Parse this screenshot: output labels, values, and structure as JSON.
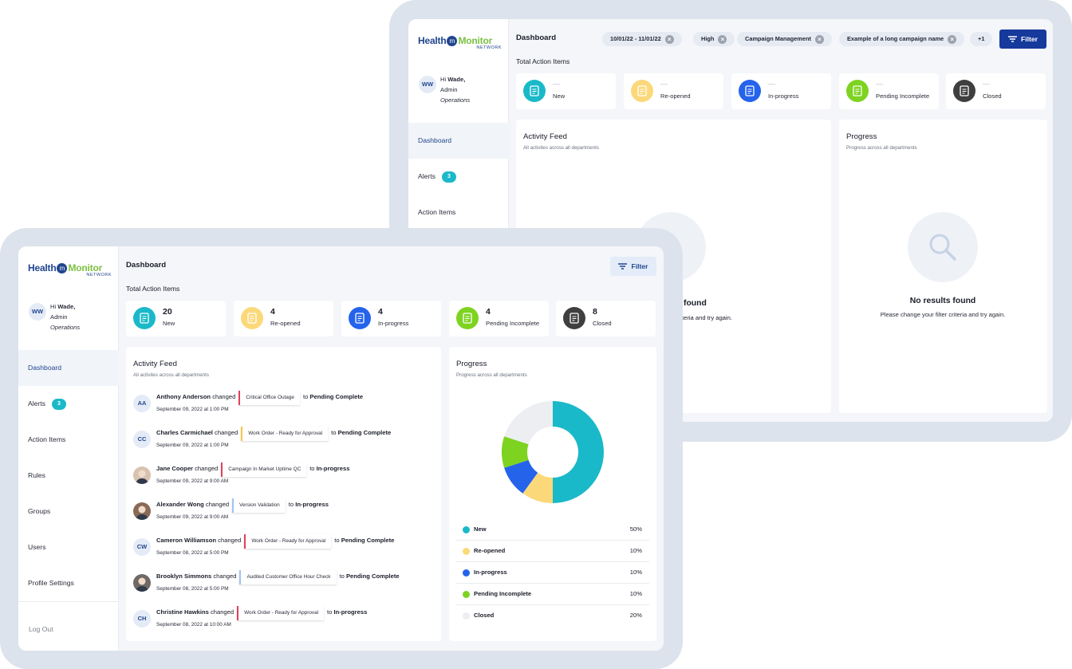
{
  "brand": {
    "health": "Health",
    "m": "m",
    "monitor": "Monitor",
    "network": "NETWORK"
  },
  "user": {
    "initials": "WW",
    "greeting": "Hi",
    "name": "Wade,",
    "role": "Admin",
    "dept": "Operations"
  },
  "back": {
    "page_title": "Dashboard",
    "filters": [
      {
        "label": "10/01/22 - 11/01/22"
      },
      {
        "label": "High"
      },
      {
        "label": "Campaign Management"
      },
      {
        "label": "Example of a long campaign name"
      }
    ],
    "more_filters": "+1",
    "filter_button": "Filter",
    "section_title": "Total Action Items",
    "stats": [
      {
        "value": "—",
        "label": "New"
      },
      {
        "value": "—",
        "label": "Re-opened"
      },
      {
        "value": "—",
        "label": "In-progress"
      },
      {
        "value": "—",
        "label": "Pending Incomplete"
      },
      {
        "value": "—",
        "label": "Closed"
      }
    ],
    "nav": [
      {
        "label": "Dashboard"
      },
      {
        "label": "Alerts",
        "badge": "3"
      },
      {
        "label": "Action Items"
      }
    ],
    "activity": {
      "title": "Activity Feed",
      "subtitle": "All activites across all departments",
      "empty_title_partial": "found",
      "empty_sub_partial": "criteria and try again."
    },
    "progress": {
      "title": "Progress",
      "subtitle": "Progress across all departments",
      "empty_title": "No results found",
      "empty_sub": "Please change your filter criteria and try again."
    }
  },
  "front": {
    "page_title": "Dashboard",
    "filter_button": "Filter",
    "section_title": "Total Action Items",
    "stats": [
      {
        "value": "20",
        "label": "New"
      },
      {
        "value": "4",
        "label": "Re-opened"
      },
      {
        "value": "4",
        "label": "In-progress"
      },
      {
        "value": "4",
        "label": "Pending Incomplete"
      },
      {
        "value": "8",
        "label": "Closed"
      }
    ],
    "nav": [
      {
        "label": "Dashboard"
      },
      {
        "label": "Alerts",
        "badge": "3"
      },
      {
        "label": "Action Items"
      },
      {
        "label": "Rules"
      },
      {
        "label": "Groups"
      },
      {
        "label": "Users"
      },
      {
        "label": "Profile Settings"
      }
    ],
    "logout": "Log Out",
    "activity": {
      "title": "Activity Feed",
      "subtitle": "All activites across all departments",
      "items": [
        {
          "initials": "AA",
          "name": "Anthony Anderson",
          "verb": "changed",
          "tag": "Critical Office Outage",
          "tag_color": "#e0415c",
          "to": "to",
          "status": "Pending Complete",
          "date": "September 09, 2022 at 1:00 PM"
        },
        {
          "initials": "CC",
          "name": "Charles Carmichael",
          "verb": "changed",
          "tag": "Work Order - Ready for Approval",
          "tag_color": "#f7c948",
          "to": "to",
          "status": "Pending Complete",
          "date": "September 09, 2022 at 1:00 PM"
        },
        {
          "initials": "",
          "name": "Jane Cooper",
          "verb": "changed",
          "tag": "Campaign In Market Uptime QC",
          "tag_color": "#e0415c",
          "to": "to",
          "status": "In-progress",
          "date": "September 09, 2022 at 9:00 AM"
        },
        {
          "initials": "",
          "name": "Alexander Wong",
          "verb": "changed",
          "tag": "Version Validation",
          "tag_color": "#9ec5f0",
          "to": "to",
          "status": "In-progress",
          "date": "September 09, 2022 at 9:00 AM"
        },
        {
          "initials": "CW",
          "name": "Cameron Williamson",
          "verb": "changed",
          "tag": "Work Order - Ready for Approval",
          "tag_color": "#e0415c",
          "to": "to",
          "status": "Pending Complete",
          "date": "September 08, 2022 at 5:00 PM"
        },
        {
          "initials": "",
          "name": "Brooklyn Simmons",
          "verb": "changed",
          "tag": "Audited Customer Office Hour Check",
          "tag_color": "#9ec5f0",
          "to": "to",
          "status": "Pending Complete",
          "date": "September 08, 2022 at 5:00 PM"
        },
        {
          "initials": "CH",
          "name": "Christine Hawkins",
          "verb": "changed",
          "tag": "Work Order - Ready for Approval",
          "tag_color": "#e0415c",
          "to": "to",
          "status": "In-progress",
          "date": "September 08, 2022 at 10:00 AM"
        }
      ]
    },
    "progress": {
      "title": "Progress",
      "subtitle": "Progress across all departments",
      "legend": [
        {
          "name": "New",
          "pct": "50%",
          "color": "#1ab9c9"
        },
        {
          "name": "Re-opened",
          "pct": "10%",
          "color": "#fbd97a"
        },
        {
          "name": "In-progress",
          "pct": "10%",
          "color": "#2563eb"
        },
        {
          "name": "Pending Incomplete",
          "pct": "10%",
          "color": "#7ed321"
        },
        {
          "name": "Closed",
          "pct": "20%",
          "color": "#eceef1"
        }
      ]
    }
  },
  "colors": {
    "navy": "#21468e",
    "green": "#7cc142",
    "new": "#1ab9c9",
    "reopened": "#fbd97a",
    "inprogress": "#2563eb",
    "pending": "#7ed321",
    "closed": "#3f3f3f"
  },
  "chart_data": {
    "type": "pie",
    "categories": [
      "New",
      "Re-opened",
      "In-progress",
      "Pending Incomplete",
      "Closed"
    ],
    "values": [
      50,
      10,
      10,
      10,
      20
    ]
  }
}
